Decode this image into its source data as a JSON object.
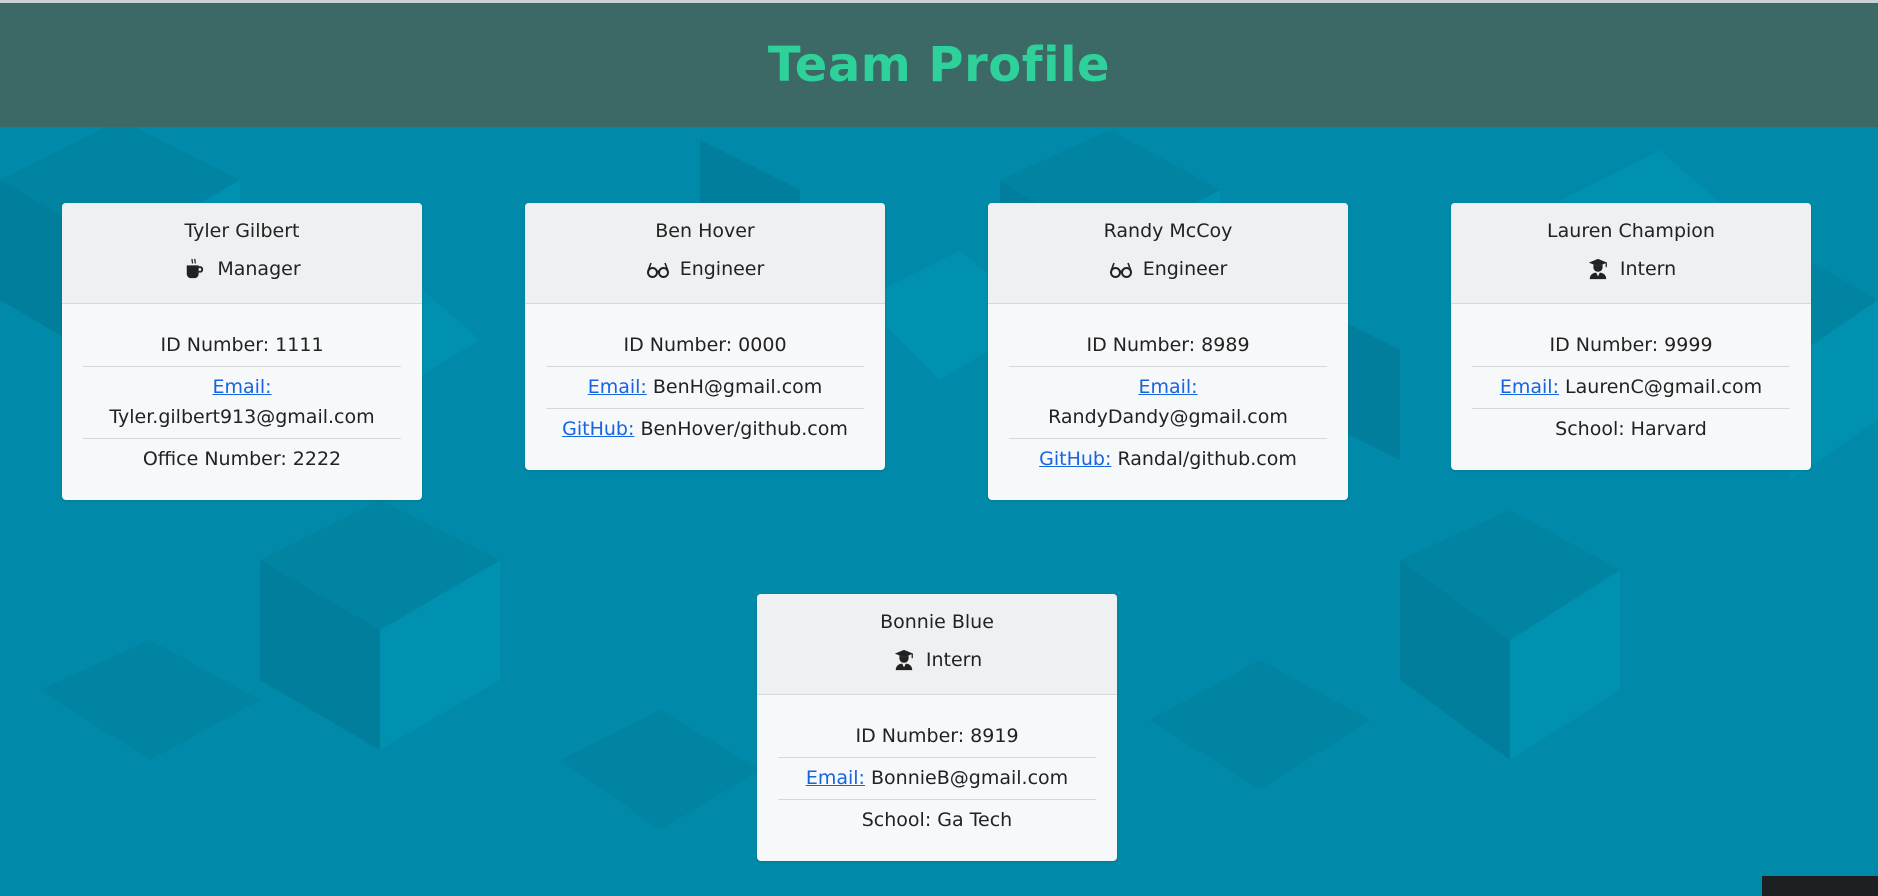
{
  "page": {
    "title": "Team Profile",
    "colors": {
      "header_bg": "#3c6866",
      "title": "#2ed19a",
      "page_bg": "#0089a8",
      "card_bg": "#f7f8fa",
      "card_head_bg": "#eef0f2",
      "link": "#1565e0"
    }
  },
  "cards": [
    {
      "name": "Tyler Gilbert",
      "role": "Manager",
      "icon": "coffee-icon",
      "id_text": "ID Number: 1111",
      "email_label": "Email:",
      "email": "Tyler.gilbert913@gmail.com",
      "extra_text": "Office Number: 2222"
    },
    {
      "name": "Ben Hover",
      "role": "Engineer",
      "icon": "glasses-icon",
      "id_text": "ID Number: 0000",
      "email_label": "Email:",
      "email": "BenH@gmail.com",
      "extra_label": "GitHub:",
      "extra_value": "BenHover/github.com"
    },
    {
      "name": "Randy McCoy",
      "role": "Engineer",
      "icon": "glasses-icon",
      "id_text": "ID Number: 8989",
      "email_label": "Email:",
      "email": "RandyDandy@gmail.com",
      "extra_label": "GitHub:",
      "extra_value": "Randal/github.com"
    },
    {
      "name": "Lauren Champion",
      "role": "Intern",
      "icon": "graduate-icon",
      "id_text": "ID Number: 9999",
      "email_label": "Email:",
      "email": "LaurenC@gmail.com",
      "extra_text": "School: Harvard"
    },
    {
      "name": "Bonnie Blue",
      "role": "Intern",
      "icon": "graduate-icon",
      "id_text": "ID Number: 8919",
      "email_label": "Email:",
      "email": "BonnieB@gmail.com",
      "extra_text": "School: Ga Tech"
    }
  ]
}
